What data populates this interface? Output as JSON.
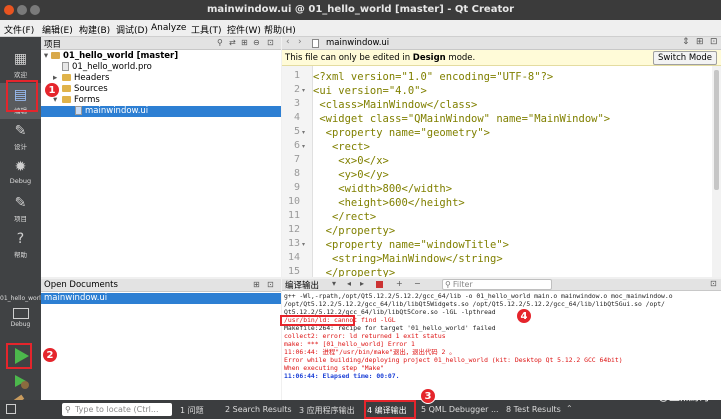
{
  "window": {
    "title": "mainwindow.ui @ 01_hello_world [master] - Qt Creator"
  },
  "menu": [
    "文件(F)",
    "编辑(E)",
    "构建(B)",
    "调试(D)",
    "Analyze",
    "工具(T)",
    "控件(W)",
    "帮助(H)"
  ],
  "modes": [
    {
      "label": "欢迎",
      "icon": "▦"
    },
    {
      "label": "编辑",
      "icon": "▤"
    },
    {
      "label": "设计",
      "icon": "✎"
    },
    {
      "label": "Debug",
      "icon": "✹"
    },
    {
      "label": "项目",
      "icon": "✎"
    },
    {
      "label": "帮助",
      "icon": "?"
    }
  ],
  "kit": {
    "project": "01_hello_world",
    "config": "Debug"
  },
  "project_pane": {
    "title": "项目",
    "tree": [
      {
        "label": "01_hello_world [master]",
        "kind": "project"
      },
      {
        "label": "01_hello_world.pro",
        "kind": "file"
      },
      {
        "label": "Headers",
        "kind": "folder"
      },
      {
        "label": "Sources",
        "kind": "folder"
      },
      {
        "label": "Forms",
        "kind": "folder"
      },
      {
        "label": "mainwindow.ui",
        "kind": "file"
      }
    ]
  },
  "open_documents": {
    "title": "Open Documents",
    "items": [
      "mainwindow.ui"
    ]
  },
  "editor": {
    "tab": "mainwindow.ui",
    "info_prefix": "This file can only be edited in ",
    "info_bold": "Design",
    "info_suffix": " mode.",
    "switch_button": "Switch Mode",
    "line_numbers": [
      "1",
      "2",
      "3",
      "4",
      "5",
      "6",
      "7",
      "8",
      "9",
      "10",
      "11",
      "12",
      "13",
      "14",
      "15"
    ],
    "lines": [
      "<?xml version=\"1.0\" encoding=\"UTF-8\"?>",
      "<ui version=\"4.0\">",
      " <class>MainWindow</class>",
      " <widget class=\"QMainWindow\" name=\"MainWindow\">",
      "  <property name=\"geometry\">",
      "   <rect>",
      "    <x>0</x>",
      "    <y>0</y>",
      "    <width>800</width>",
      "    <height>600</height>",
      "   </rect>",
      "  </property>",
      "  <property name=\"windowTitle\">",
      "   <string>MainWindow</string>",
      "  </property>"
    ]
  },
  "output": {
    "title": "编译输出",
    "filter_placeholder": "Filter",
    "lines": [
      {
        "text": "g++ -Wl,-rpath,/opt/Qt5.12.2/5.12.2/gcc_64/lib -o 01_hello_world main.o mainwindow.o moc_mainwindow.o",
        "style": "normal"
      },
      {
        "text": "/opt/Qt5.12.2/5.12.2/gcc_64/lib/libQt5Widgets.so /opt/Qt5.12.2/5.12.2/gcc_64/lib/libQt5Gui.so /opt/",
        "style": "normal"
      },
      {
        "text": "Qt5.12.2/5.12.2/gcc_64/lib/libQt5Core.so -lGL -lpthread",
        "style": "normal"
      },
      {
        "text": "/usr/bin/ld: cannot find -lGL",
        "style": "red"
      },
      {
        "text": "Makefile:264: recipe for target '01_hello_world' failed",
        "style": "normal"
      },
      {
        "text": "collect2: error: ld returned 1 exit status",
        "style": "red"
      },
      {
        "text": "make: *** [01_hello_world] Error 1",
        "style": "red"
      },
      {
        "text": "11:06:44: 进程\"/usr/bin/make\"退出，退出代码 2 。",
        "style": "red"
      },
      {
        "text": "Error while building/deploying project 01_hello_world (kit: Desktop Qt 5.12.2 GCC 64bit)",
        "style": "red"
      },
      {
        "text": "When executing step \"Make\"",
        "style": "red"
      },
      {
        "text": "11:06:44: Elapsed time: 00:07.",
        "style": "blue"
      }
    ]
  },
  "statusbar": {
    "locate_placeholder": "Type to locate (Ctrl...",
    "tabs": [
      "1 问题",
      "2 Search Results",
      "3 应用程序输出",
      "4 编译输出",
      "5 QML Debugger ...",
      "8 Test Results"
    ]
  },
  "annotations": [
    "1",
    "2",
    "3",
    "4"
  ],
  "watermark": "CSDN @正点原子",
  "colors": {
    "accent": "#2d7fd3",
    "annotation": "#e5252c",
    "modebar": "#404244"
  }
}
